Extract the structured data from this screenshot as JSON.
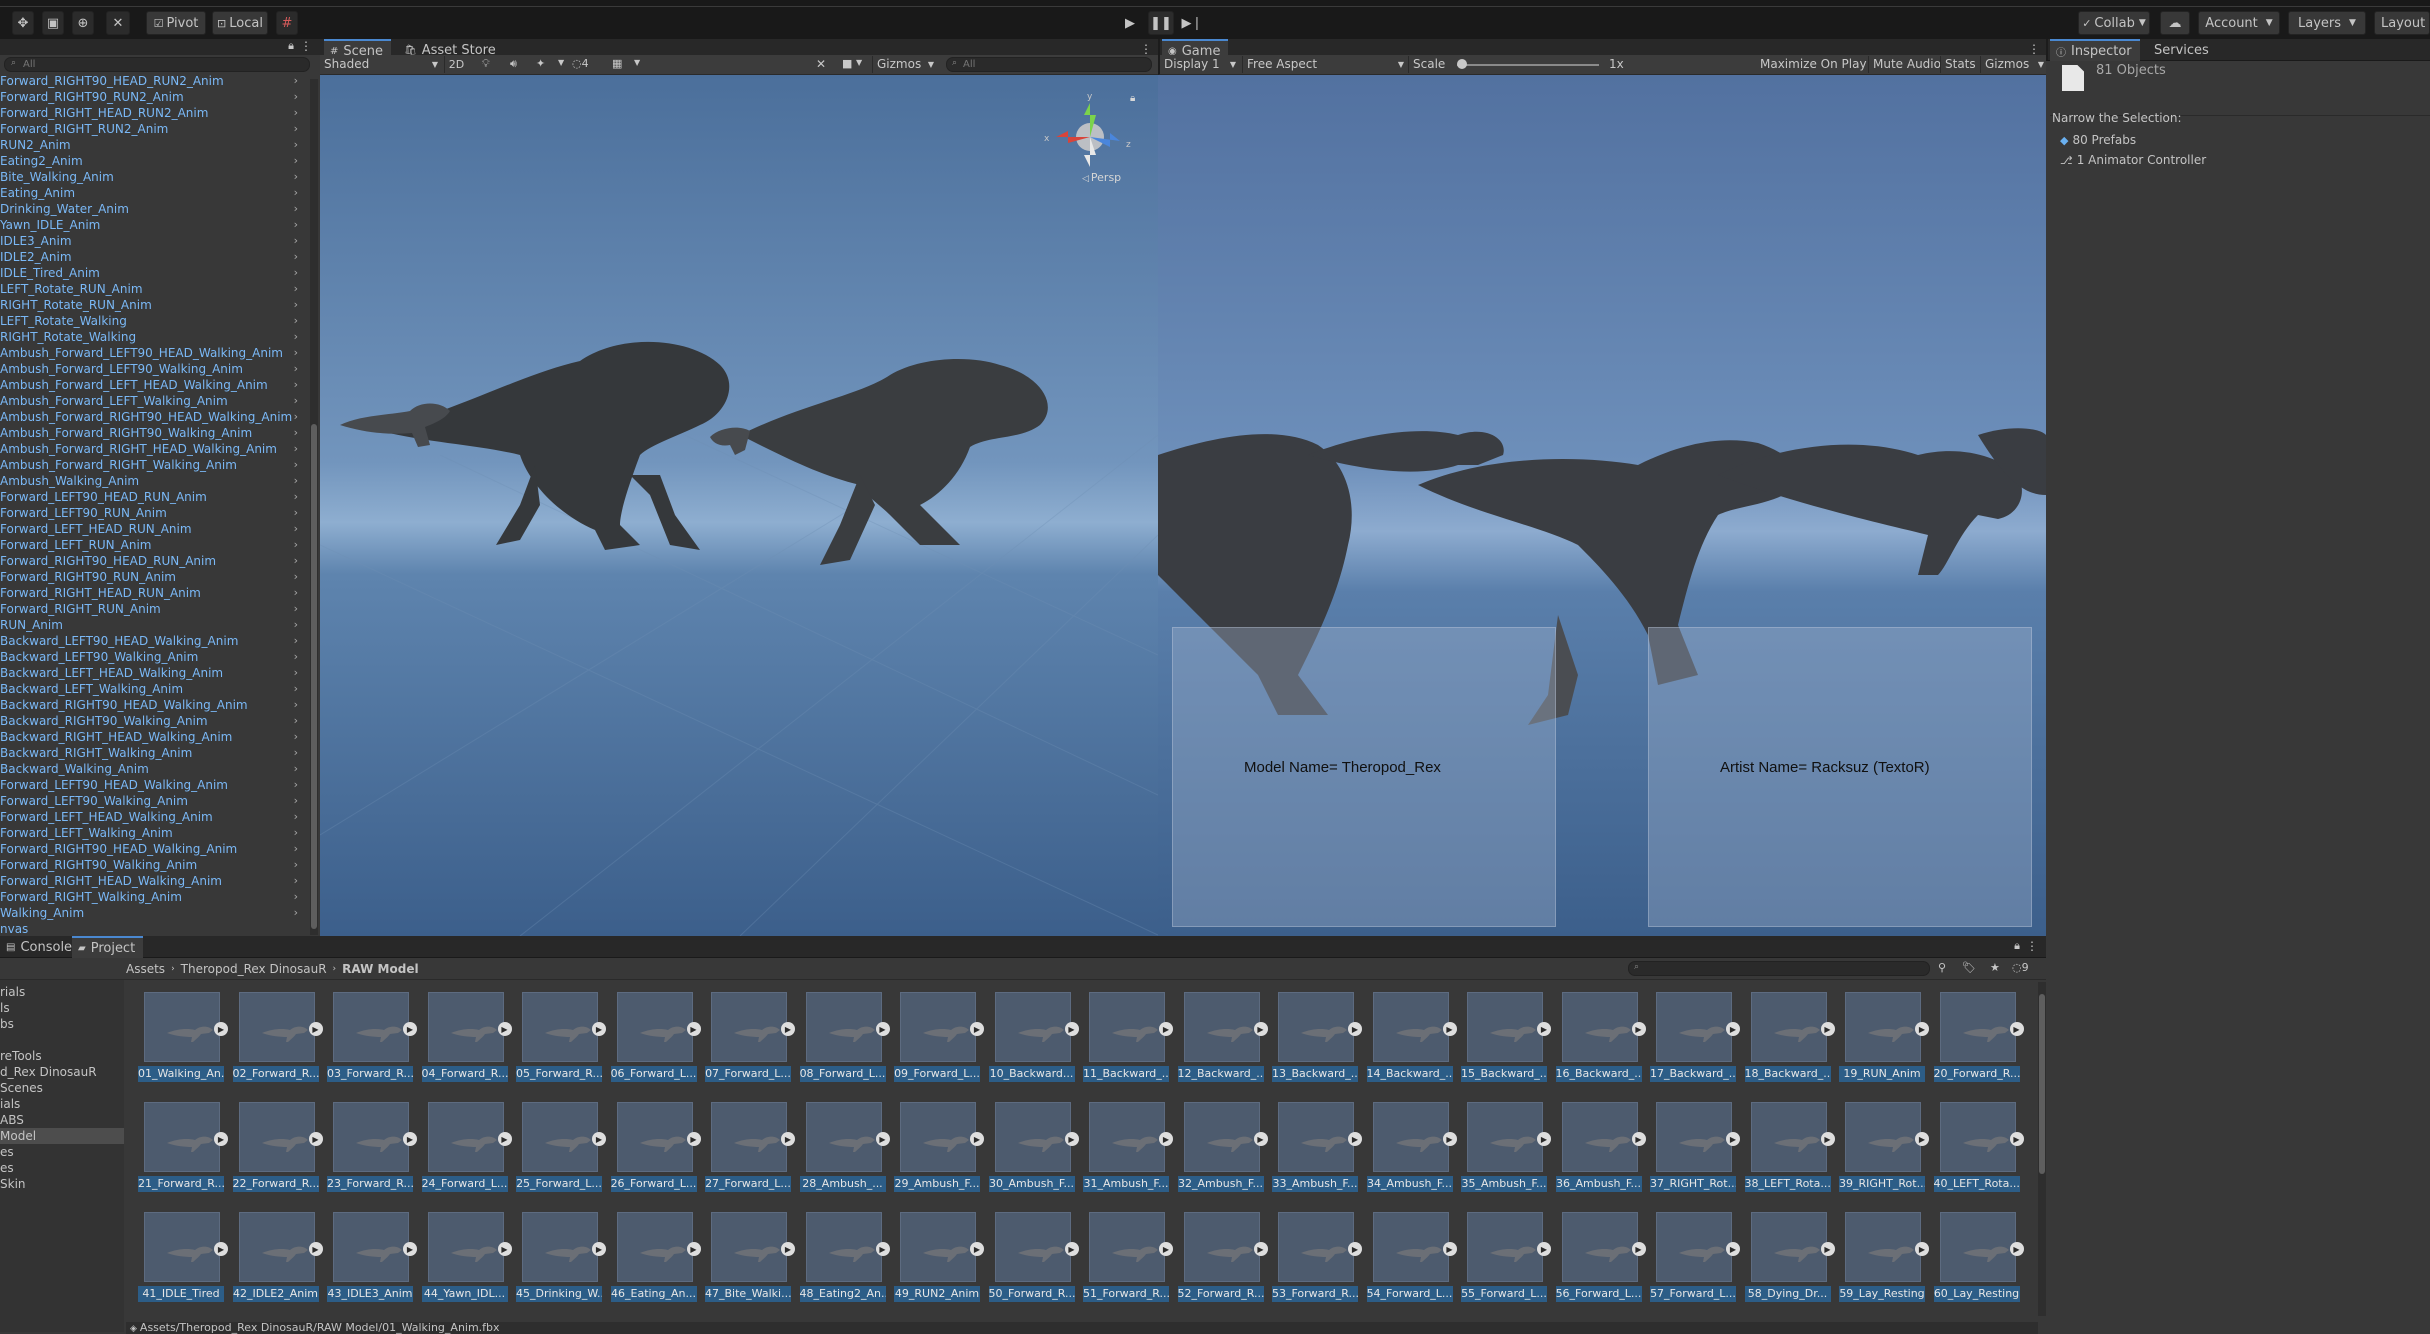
{
  "toolbar": {
    "pivot": "Pivot",
    "local": "Local",
    "collab": "Collab",
    "account": "Account",
    "layers": "Layers",
    "layout": "Layout"
  },
  "hierarchy": {
    "search_placeholder": "All",
    "items": [
      "Forward_RIGHT90_HEAD_RUN2_Anim",
      "Forward_RIGHT90_RUN2_Anim",
      "Forward_RIGHT_HEAD_RUN2_Anim",
      "Forward_RIGHT_RUN2_Anim",
      "RUN2_Anim",
      "Eating2_Anim",
      "Bite_Walking_Anim",
      "Eating_Anim",
      "Drinking_Water_Anim",
      "Yawn_IDLE_Anim",
      "IDLE3_Anim",
      "IDLE2_Anim",
      "IDLE_Tired_Anim",
      "LEFT_Rotate_RUN_Anim",
      "RIGHT_Rotate_RUN_Anim",
      "LEFT_Rotate_Walking",
      "RIGHT_Rotate_Walking",
      "Ambush_Forward_LEFT90_HEAD_Walking_Anim",
      "Ambush_Forward_LEFT90_Walking_Anim",
      "Ambush_Forward_LEFT_HEAD_Walking_Anim",
      "Ambush_Forward_LEFT_Walking_Anim",
      "Ambush_Forward_RIGHT90_HEAD_Walking_Anim",
      "Ambush_Forward_RIGHT90_Walking_Anim",
      "Ambush_Forward_RIGHT_HEAD_Walking_Anim",
      "Ambush_Forward_RIGHT_Walking_Anim",
      "Ambush_Walking_Anim",
      "Forward_LEFT90_HEAD_RUN_Anim",
      "Forward_LEFT90_RUN_Anim",
      "Forward_LEFT_HEAD_RUN_Anim",
      "Forward_LEFT_RUN_Anim",
      "Forward_RIGHT90_HEAD_RUN_Anim",
      "Forward_RIGHT90_RUN_Anim",
      "Forward_RIGHT_HEAD_RUN_Anim",
      "Forward_RIGHT_RUN_Anim",
      "RUN_Anim",
      "Backward_LEFT90_HEAD_Walking_Anim",
      "Backward_LEFT90_Walking_Anim",
      "Backward_LEFT_HEAD_Walking_Anim",
      "Backward_LEFT_Walking_Anim",
      "Backward_RIGHT90_HEAD_Walking_Anim",
      "Backward_RIGHT90_Walking_Anim",
      "Backward_RIGHT_HEAD_Walking_Anim",
      "Backward_RIGHT_Walking_Anim",
      "Backward_Walking_Anim",
      "Forward_LEFT90_HEAD_Walking_Anim",
      "Forward_LEFT90_Walking_Anim",
      "Forward_LEFT_HEAD_Walking_Anim",
      "Forward_LEFT_Walking_Anim",
      "Forward_RIGHT90_HEAD_Walking_Anim",
      "Forward_RIGHT90_Walking_Anim",
      "Forward_RIGHT_HEAD_Walking_Anim",
      "Forward_RIGHT_Walking_Anim",
      "Walking_Anim",
      "nvas"
    ]
  },
  "scene": {
    "tab_scene": "Scene",
    "tab_asset_store": "Asset Store",
    "shading": "Shaded",
    "mode_2d": "2D",
    "hidden_count": "4",
    "gizmos": "Gizmos",
    "search_placeholder": "All",
    "persp": "Persp"
  },
  "game": {
    "tab": "Game",
    "display": "Display 1",
    "aspect": "Free Aspect",
    "scale_label": "Scale",
    "scale_value": "1x",
    "scale_fraction": 0.0,
    "maximize": "Maximize On Play",
    "mute": "Mute Audio",
    "stats": "Stats",
    "gizmos": "Gizmos",
    "model_name": "Model Name= Theropod_Rex",
    "artist_name": "Artist Name= Racksuz (TextoR)"
  },
  "inspector": {
    "tab_inspector": "Inspector",
    "tab_services": "Services",
    "objects": "81 Objects",
    "narrow": "Narrow the Selection:",
    "prefabs": "80 Prefabs",
    "animator": "1 Animator Controller"
  },
  "project": {
    "tab_console": "Console",
    "tab_project": "Project",
    "breadcrumb": [
      "Assets",
      "Theropod_Rex DinosauR",
      "RAW Model"
    ],
    "hidden_count": "9",
    "status_path": "Assets/Theropod_Rex DinosauR/RAW Model/01_Walking_Anim.fbx",
    "tree": [
      "rials",
      "ls",
      "bs",
      "",
      "reTools",
      "d_Rex DinosauR",
      "Scenes",
      "ials",
      "ABS",
      "Model",
      "es",
      "es",
      "Skin"
    ],
    "assets": [
      "01_Walking_An...",
      "02_Forward_R...",
      "03_Forward_R...",
      "04_Forward_R...",
      "05_Forward_R...",
      "06_Forward_L...",
      "07_Forward_L...",
      "08_Forward_L...",
      "09_Forward_L...",
      "10_Backward...",
      "11_Backward_...",
      "12_Backward_...",
      "13_Backward_...",
      "14_Backward_...",
      "15_Backward_...",
      "16_Backward_...",
      "17_Backward_...",
      "18_Backward_...",
      "19_RUN_Anim",
      "20_Forward_R...",
      "21_Forward_R...",
      "22_Forward_R...",
      "23_Forward_R...",
      "24_Forward_L...",
      "25_Forward_L...",
      "26_Forward_L...",
      "27_Forward_L...",
      "28_Ambush_...",
      "29_Ambush_F...",
      "30_Ambush_F...",
      "31_Ambush_F...",
      "32_Ambush_F...",
      "33_Ambush_F...",
      "34_Ambush_F...",
      "35_Ambush_F...",
      "36_Ambush_F...",
      "37_RIGHT_Rot...",
      "38_LEFT_Rota...",
      "39_RIGHT_Rot...",
      "40_LEFT_Rota...",
      "41_IDLE_Tired",
      "42_IDLE2_Anim",
      "43_IDLE3_Anim",
      "44_Yawn_IDL...",
      "45_Drinking_W...",
      "46_Eating_An...",
      "47_Bite_Walki...",
      "48_Eating2_An...",
      "49_RUN2_Anim",
      "50_Forward_R...",
      "51_Forward_R...",
      "52_Forward_R...",
      "53_Forward_R...",
      "54_Forward_L...",
      "55_Forward_L...",
      "56_Forward_L...",
      "57_Forward_L...",
      "58_Dying_Dr...",
      "59_Lay_Resting",
      "60_Lay_Resting"
    ]
  }
}
